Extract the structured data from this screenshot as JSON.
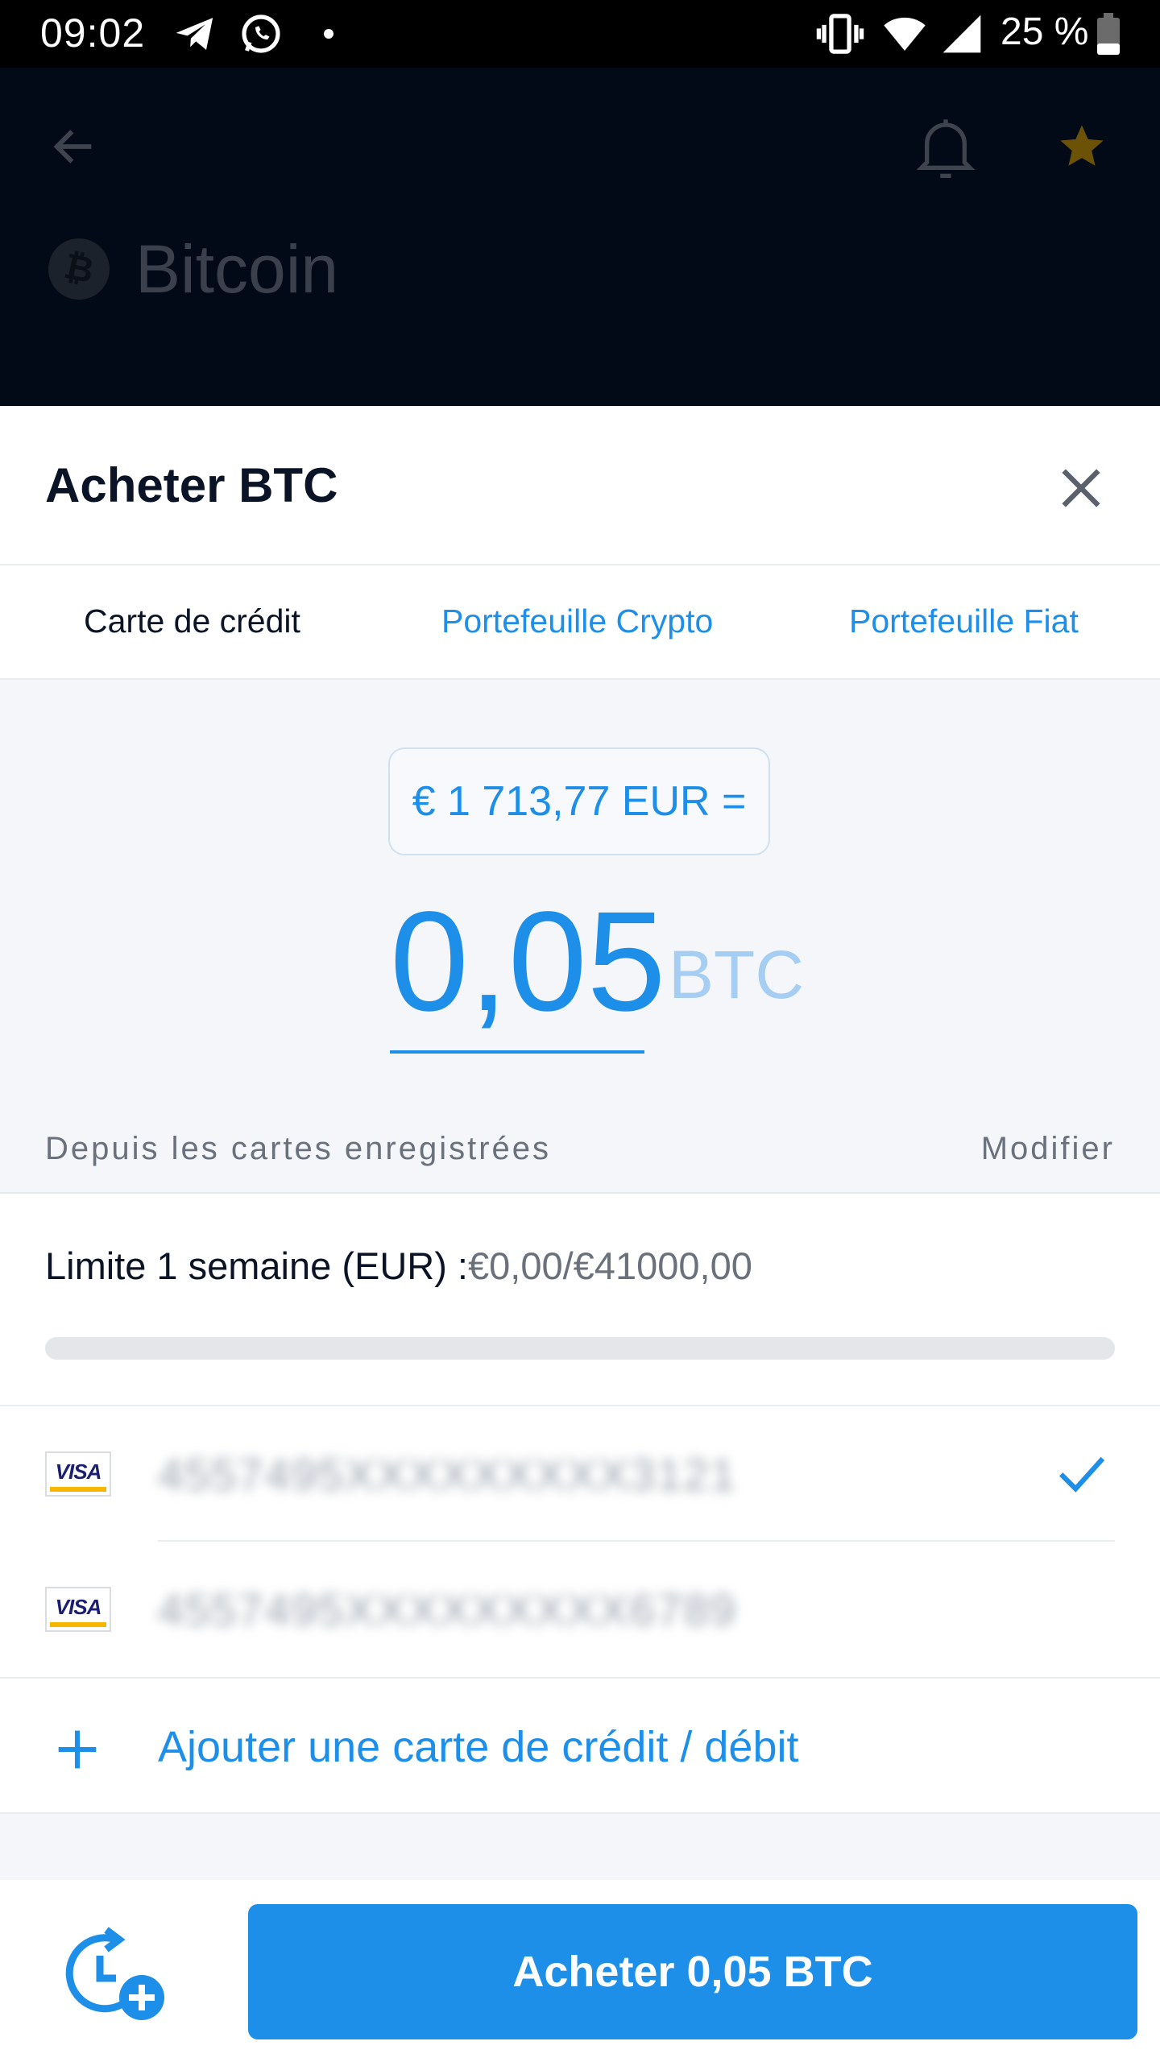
{
  "status_bar": {
    "time": "09:02",
    "battery": "25 %",
    "icons": [
      "telegram-icon",
      "whatsapp-icon",
      "dot-icon",
      "vibrate-icon",
      "wifi-icon",
      "signal-icon",
      "battery-icon"
    ]
  },
  "header": {
    "title": "Bitcoin",
    "coin_symbol": "₿"
  },
  "sheet": {
    "title": "Acheter BTC"
  },
  "tabs": [
    {
      "label": "Carte de crédit",
      "active": true
    },
    {
      "label": "Portefeuille Crypto",
      "active": false
    },
    {
      "label": "Portefeuille Fiat",
      "active": false
    }
  ],
  "amount": {
    "fiat_equivalent": "€ 1 713,77 EUR =",
    "value": "0,05",
    "unit": "BTC"
  },
  "source": {
    "label": "Depuis les cartes enregistrées",
    "modify_label": "Modifier"
  },
  "limit": {
    "label": "Limite 1 semaine (EUR) :",
    "value": "€0,00/€41000,00",
    "used_fraction": 0.0
  },
  "cards": [
    {
      "brand": "VISA",
      "number": "4557495XXXXXXXXX3121",
      "selected": true
    },
    {
      "brand": "VISA",
      "number": "4557495XXXXXXXXX6789",
      "selected": false
    }
  ],
  "add_card": {
    "label": "Ajouter une carte de crédit / débit"
  },
  "buy_button": {
    "label": "Acheter 0,05 BTC"
  },
  "colors": {
    "accent": "#1d8fe8",
    "header_bg": "#030a17",
    "favorite_star": "#6b5206"
  }
}
